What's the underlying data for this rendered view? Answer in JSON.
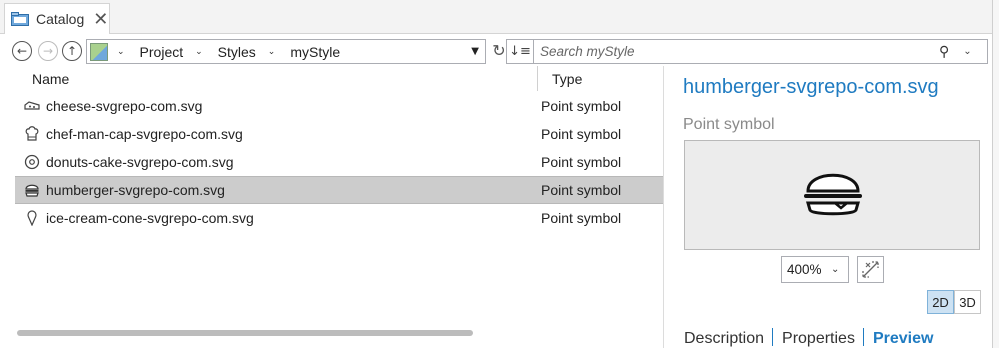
{
  "tab": {
    "label": "Catalog",
    "close": "✕"
  },
  "toolbar": {
    "back_glyph": "←",
    "forward_glyph": "→",
    "up_glyph": "↑",
    "breadcrumbs": [
      "Project",
      "Styles",
      "myStyle"
    ],
    "refresh_glyph": "↻",
    "sort_glyph": "↓≡",
    "search_placeholder": "Search myStyle",
    "search_glyph": "⚲",
    "chevron": "⌄"
  },
  "list": {
    "columns": [
      "Name",
      "Type"
    ],
    "rows": [
      {
        "name": "cheese-svgrepo-com.svg",
        "type": "Point symbol",
        "icon": "cheese-icon"
      },
      {
        "name": "chef-man-cap-svgrepo-com.svg",
        "type": "Point symbol",
        "icon": "chef-cap-icon"
      },
      {
        "name": "donuts-cake-svgrepo-com.svg",
        "type": "Point symbol",
        "icon": "donut-icon"
      },
      {
        "name": "humberger-svgrepo-com.svg",
        "type": "Point symbol",
        "icon": "burger-icon",
        "selected": true
      },
      {
        "name": "ice-cream-cone-svgrepo-com.svg",
        "type": "Point symbol",
        "icon": "ice-cream-icon"
      }
    ]
  },
  "preview": {
    "title": "humberger-svgrepo-com.svg",
    "type": "Point symbol",
    "zoom": "400%",
    "mode_2d": "2D",
    "mode_3d": "3D",
    "tabs": [
      "Description",
      "Properties",
      "Preview"
    ],
    "active_tab": "Preview"
  },
  "colors": {
    "accent": "#1f7bc1",
    "selection": "#cccccc",
    "active_mode": "#cde2f3"
  }
}
